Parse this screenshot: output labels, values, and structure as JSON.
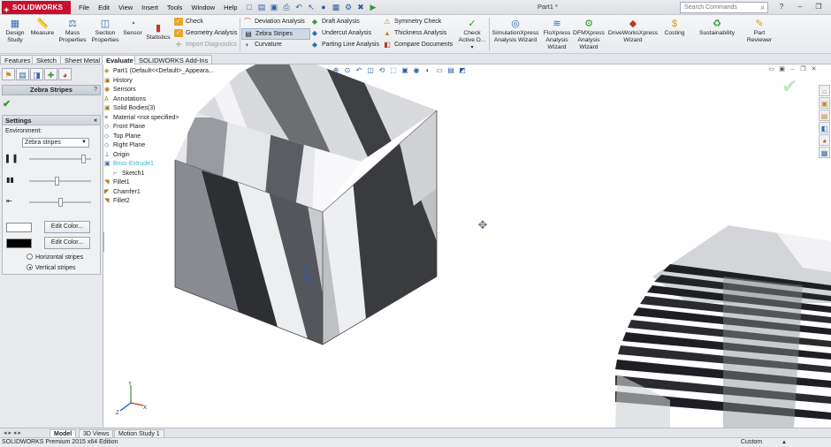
{
  "app": {
    "logo_text": "SOLIDWORKS",
    "doc_title": "Part1 *",
    "menu": [
      "File",
      "Edit",
      "View",
      "Insert",
      "Tools",
      "Window",
      "Help"
    ],
    "search_placeholder": "Search Commands",
    "window_buttons": [
      "?",
      "–",
      "❐",
      "✕"
    ]
  },
  "ribbon": {
    "big_buttons": [
      {
        "label": "Design\nStudy",
        "icon": "design-study-icon"
      },
      {
        "label": "Measure",
        "icon": "measure-icon"
      },
      {
        "label": "Mass\nProperties",
        "icon": "mass-properties-icon"
      },
      {
        "label": "Section\nProperties",
        "icon": "section-properties-icon"
      },
      {
        "label": "Sensor",
        "icon": "sensor-icon"
      },
      {
        "label": "Statistics",
        "icon": "statistics-icon"
      }
    ],
    "check_col": [
      "Check",
      "Geometry Analysis",
      "Import Diagnostics"
    ],
    "col2": [
      "Deviation Analysis",
      "Zebra Stripes",
      "Curvature"
    ],
    "col3": [
      "Draft Analysis",
      "Undercut Analysis",
      "Parting Line Analysis"
    ],
    "col4": [
      "Symmetry Check",
      "Thickness Analysis",
      "Compare Documents"
    ],
    "check_active": "Check\nActive D...",
    "right_buttons": [
      {
        "label": "SimulationXpress\nAnalysis Wizard",
        "icon": "simulationxpress-icon"
      },
      {
        "label": "FloXpress\nAnalysis\nWizard",
        "icon": "floxpress-icon"
      },
      {
        "label": "DFMXpress\nAnalysis\nWizard",
        "icon": "dfmxpress-icon"
      },
      {
        "label": "DriveWorksXpress\nWizard",
        "icon": "driveworksxpress-icon"
      },
      {
        "label": "Costing",
        "icon": "costing-icon"
      },
      {
        "label": "Sustainability",
        "icon": "sustainability-icon"
      },
      {
        "label": "Part\nReviewer",
        "icon": "part-reviewer-icon"
      }
    ]
  },
  "tabs": [
    "Features",
    "Sketch",
    "Sheet Metal",
    "Evaluate",
    "SOLIDWORKS Add-Ins"
  ],
  "active_tab": "Evaluate",
  "property_manager": {
    "title": "Zebra Stripes",
    "help": "?",
    "settings_title": "Settings",
    "environment_label": "Environment:",
    "environment_value": "Zebra stripes",
    "edit_color_1": "Edit Color...",
    "edit_color_2": "Edit Color...",
    "color_1": "#ffffff",
    "color_2": "#000000",
    "radio_horizontal": "Horizontal stripes",
    "radio_vertical": "Vertical stripes",
    "selected_stripes": "vertical",
    "slider_1_level": 0.9,
    "slider_2_level": 0.45,
    "slider_3_level": 0.5
  },
  "feature_tree": [
    {
      "label": "Part1  (Default<<Default>_Appeara...",
      "icon": "part-icon"
    },
    {
      "label": "History",
      "icon": "history-icon"
    },
    {
      "label": "Sensors",
      "icon": "sensors-icon"
    },
    {
      "label": "Annotations",
      "icon": "annotations-icon"
    },
    {
      "label": "Solid Bodies(3)",
      "icon": "solid-bodies-icon"
    },
    {
      "label": "Material <not specified>",
      "icon": "material-icon"
    },
    {
      "label": "Front Plane",
      "icon": "plane-icon"
    },
    {
      "label": "Top Plane",
      "icon": "plane-icon"
    },
    {
      "label": "Right Plane",
      "icon": "plane-icon"
    },
    {
      "label": "Origin",
      "icon": "origin-icon"
    },
    {
      "label": "Boss-Extrude1",
      "icon": "extrude-icon"
    },
    {
      "label": "Sketch1",
      "icon": "sketch-icon"
    },
    {
      "label": "Fillet1",
      "icon": "fillet-icon"
    },
    {
      "label": "Chamfer1",
      "icon": "chamfer-icon"
    },
    {
      "label": "Fillet2",
      "icon": "fillet-icon"
    }
  ],
  "bottom_tabs": [
    "Model",
    "3D Views",
    "Motion Study 1"
  ],
  "active_bottom_tab": "Model",
  "status": {
    "edition": "SOLIDWORKS Premium 2015 x64 Edition",
    "units": "Custom"
  }
}
